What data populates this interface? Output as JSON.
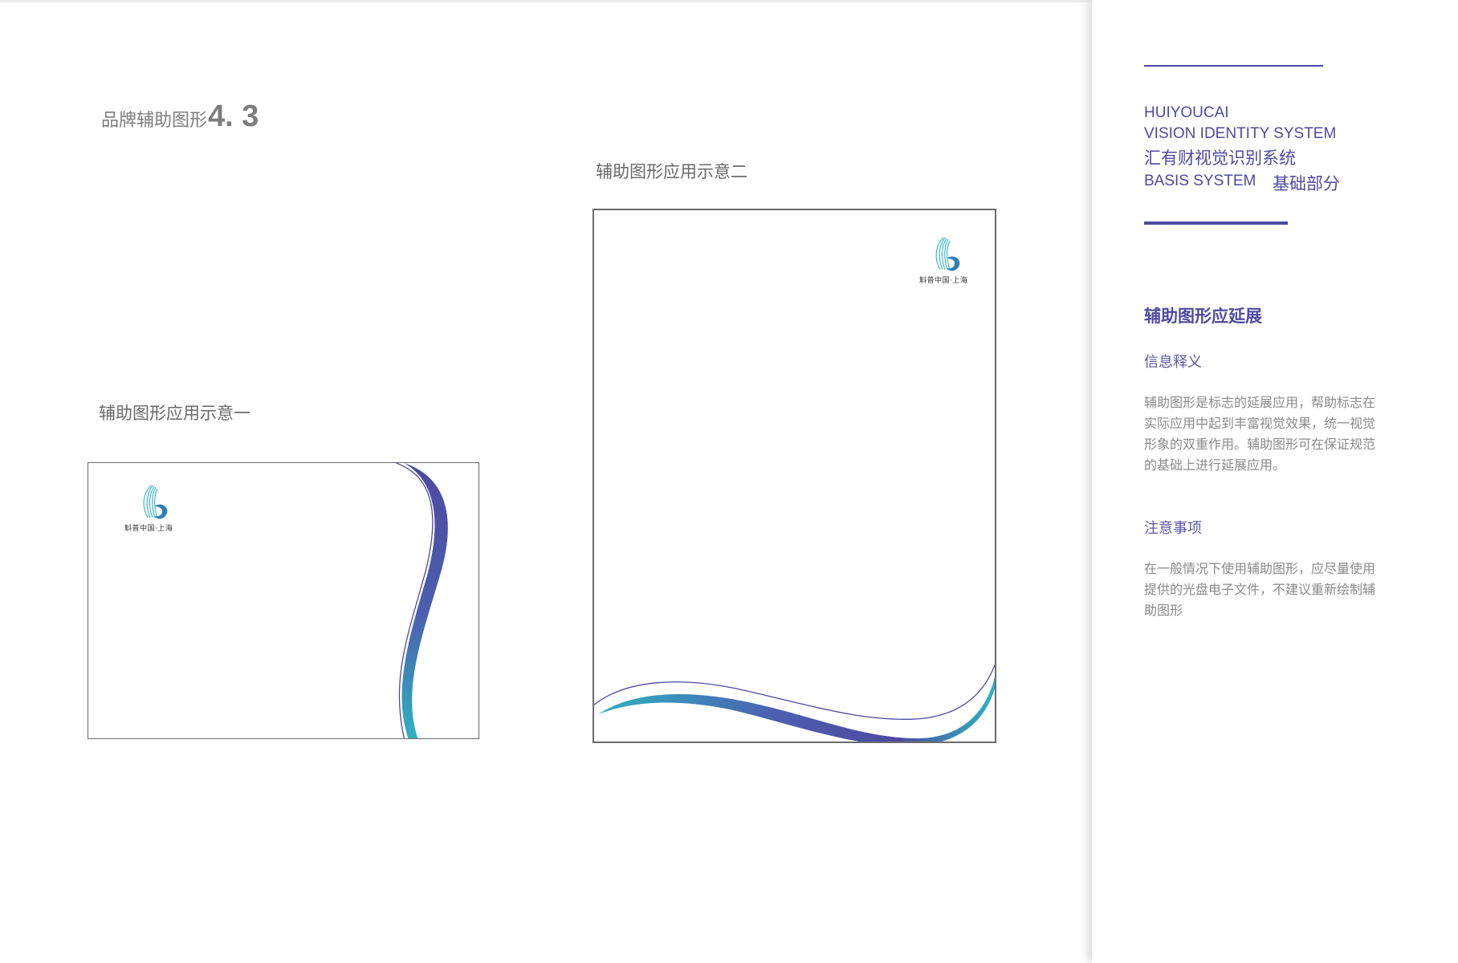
{
  "page": {
    "title_zh": "品牌辅助图形",
    "title_num": "4. 3"
  },
  "examples": [
    {
      "caption": "辅助图形应用示意一",
      "logo_text": "斛普中国·上海"
    },
    {
      "caption": "辅助图形应用示意二",
      "logo_text": "斛普中国·上海"
    }
  ],
  "sidebar": {
    "brand_en1": "HUIYOUCAI",
    "brand_en2": "VISION IDENTITY SYSTEM",
    "brand_zh": "汇有财视觉识别系统",
    "basis_en": "BASIS SYSTEM",
    "basis_zh": "基础部分",
    "section_title": "辅助图形应延展",
    "info_title": "信息释义",
    "info_text": "辅助图形是标志的延展应用，帮助标志在实际应用中起到丰富视觉效果，统一视觉形象的双重作用。辅助图形可在保证规范的基础上进行延展应用。",
    "notes_title": "注意事项",
    "notes_text": "在一般情况下使用辅助图形，应尽量使用提供的光盘电子文件，不建议重新绘制辅助图形"
  },
  "colors": {
    "brand_purple": "#4e4aa0",
    "accent_teal": "#2fb3c0",
    "gray_text": "#8a8a8a"
  },
  "icons": {
    "logo": "shell-wave-logo-icon"
  }
}
